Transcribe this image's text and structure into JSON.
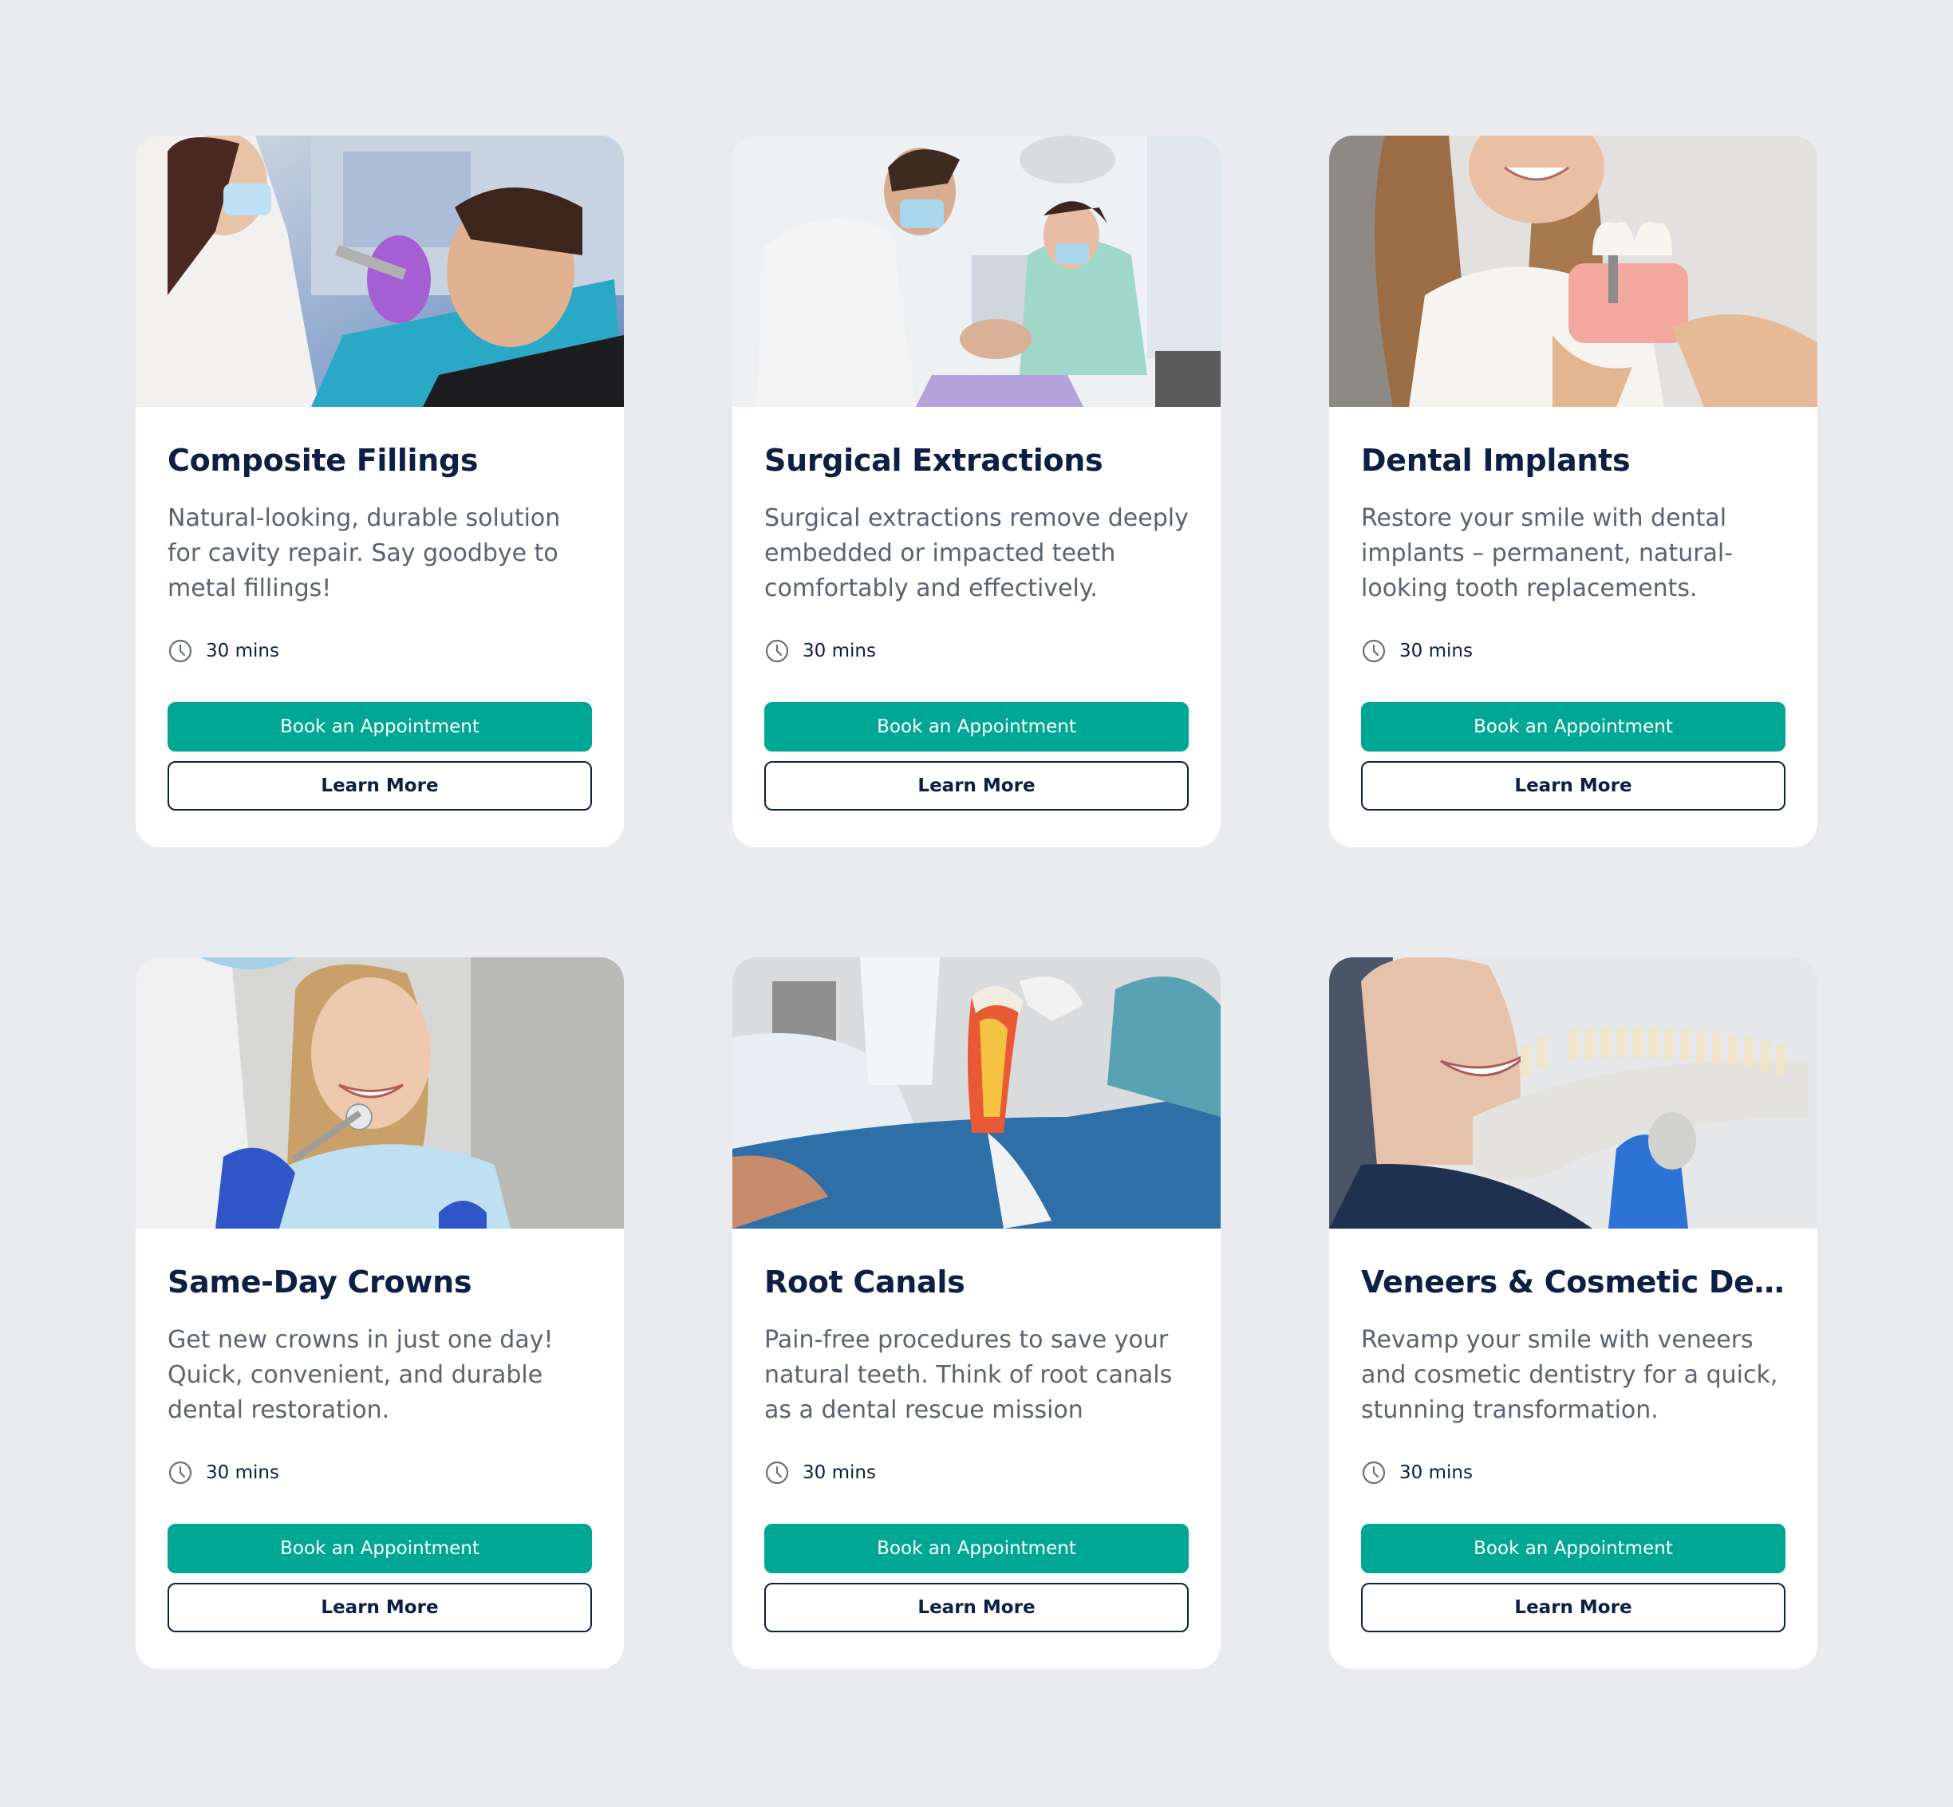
{
  "colors": {
    "page_bg": "#e9ebef",
    "card_bg": "#ffffff",
    "title": "#0d1f44",
    "body_text": "#5c6273",
    "accent": "#00a795"
  },
  "services": [
    {
      "title": "Composite Fillings",
      "description": "Natural-looking, durable solution for cavity repair. Say goodbye to metal fillings!",
      "duration": "30 mins",
      "book_label": "Book an Appointment",
      "learn_label": "Learn More",
      "image": "dentist-treating-patient-photo"
    },
    {
      "title": "Surgical Extractions",
      "description": "Surgical extractions remove deeply embedded or impacted teeth comfortably and effectively.",
      "duration": "30 mins",
      "book_label": "Book an Appointment",
      "learn_label": "Learn More",
      "image": "surgeon-and-assistant-photo"
    },
    {
      "title": "Dental Implants",
      "description": "Restore your smile with dental implants – permanent, natural-looking tooth replacements.",
      "duration": "30 mins",
      "book_label": "Book an Appointment",
      "learn_label": "Learn More",
      "image": "implant-model-photo"
    },
    {
      "title": "Same-Day Crowns",
      "description": "Get new crowns in just one day! Quick, convenient, and durable dental restoration.",
      "duration": "30 mins",
      "book_label": "Book an Appointment",
      "learn_label": "Learn More",
      "image": "smiling-patient-photo"
    },
    {
      "title": "Root Canals",
      "description": "Pain-free procedures to save your natural teeth. Think of root canals as a dental rescue mission",
      "duration": "30 mins",
      "book_label": "Book an Appointment",
      "learn_label": "Learn More",
      "image": "tooth-cross-section-model-photo"
    },
    {
      "title": "Veneers & Cosmetic Denti...",
      "description": "Revamp your smile with veneers and cosmetic dentistry for a quick, stunning transformation.",
      "duration": "30 mins",
      "book_label": "Book an Appointment",
      "learn_label": "Learn More",
      "image": "tooth-shade-guide-photo"
    }
  ]
}
